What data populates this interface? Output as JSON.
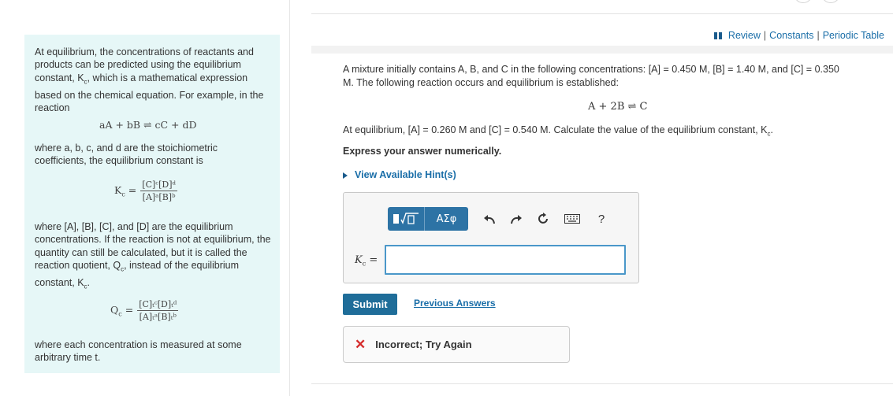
{
  "header": {
    "links": [
      "Review",
      "Constants",
      "Periodic Table"
    ],
    "separator": "|"
  },
  "intro": {
    "p1": "At equilibrium, the concentrations of reactants and products can be predicted using the equilibrium constant, K",
    "p1_sub": "c",
    "p1_end": ", which is a mathematical expression based on the chemical equation. For example, in the reaction",
    "general_reaction": "aA + bB ⇌ cC + dD",
    "p2": "where a, b, c, and d are the stoichiometric coefficients, the equilibrium constant is",
    "kc_lhs": "K",
    "kc_num": "[C]ᶜ[D]ᵈ",
    "kc_den": "[A]ᵃ[B]ᵇ",
    "p3": "where [A], [B], [C], and [D] are the equilibrium concentrations. If the reaction is not at equilibrium, the quantity can still be calculated, but it is called the reaction quotient, Q",
    "p3_sub": "c",
    "p3_mid": ", instead of the equilibrium constant, K",
    "p3_end": ".",
    "qc_lhs": "Q",
    "qc_num": "[C]ₜᶜ[D]ₜᵈ",
    "qc_den": "[A]ₜᵃ[B]ₜᵇ",
    "p4": "where each concentration is measured at some arbitrary time t."
  },
  "question": {
    "line1": "A mixture initially contains A, B, and C in the following concentrations: [A] = 0.450 M, [B] = 1.40 M, and [C] = 0.350",
    "line2": "M. The following reaction occurs and equilibrium is established:",
    "reaction": "A + 2B ⇌ C",
    "eq_line": "At equilibrium, [A] = 0.260 M and [C] = 0.540 M. Calculate the value of the equilibrium constant, K",
    "eq_sub": "c",
    "eq_end": ".",
    "instruction": "Express your answer numerically.",
    "hint": "View Available Hint(s)"
  },
  "answer": {
    "toolbar": {
      "templates_label": "▯√▯",
      "greek_label": "ΑΣφ",
      "icons": [
        "undo-icon",
        "redo-icon",
        "reset-icon",
        "keyboard-icon",
        "help-icon"
      ],
      "help": "?"
    },
    "input_label": "K",
    "input_label_sub": "c",
    "input_label_eq": "=",
    "value": ""
  },
  "actions": {
    "submit": "Submit",
    "previous": "Previous Answers"
  },
  "feedback": {
    "text": "Incorrect; Try Again",
    "color": "#d52b2b"
  }
}
